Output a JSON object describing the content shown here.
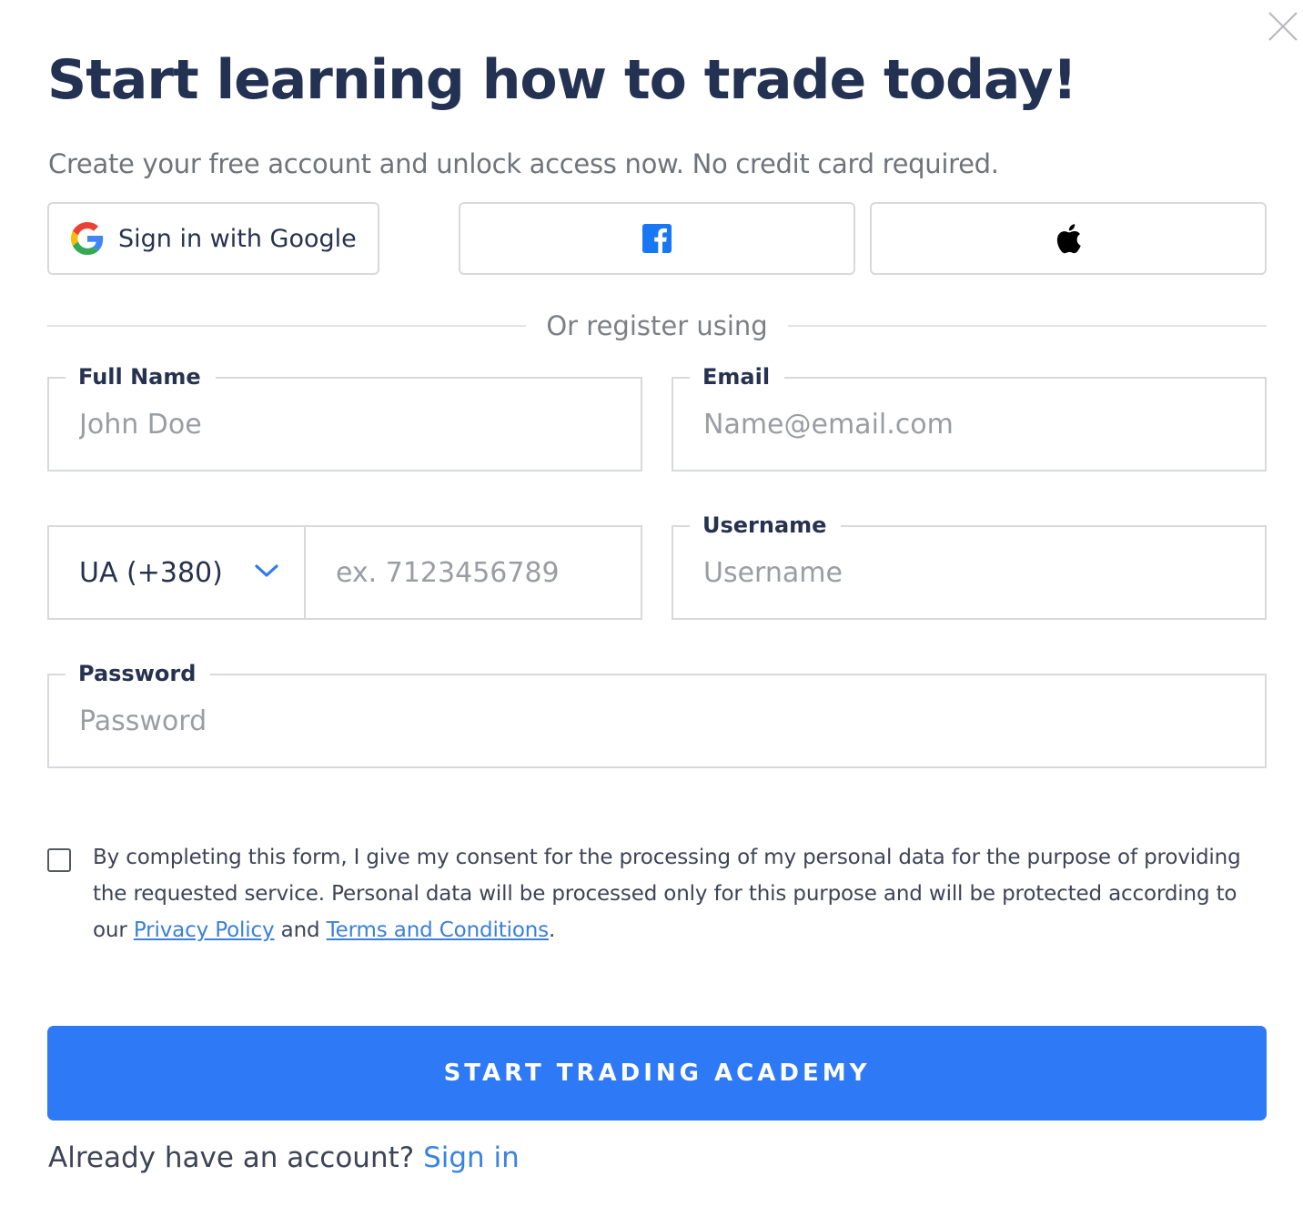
{
  "title": "Start learning how to trade today!",
  "subtitle": "Create your free account and unlock access now. No credit card required.",
  "social": {
    "google_label": "Sign in with Google",
    "facebook_icon": "facebook-icon",
    "apple_icon": "apple-icon"
  },
  "divider_text": "Or register using",
  "fields": {
    "full_name": {
      "label": "Full Name",
      "placeholder": "John Doe"
    },
    "email": {
      "label": "Email",
      "placeholder": "Name@email.com"
    },
    "phone": {
      "country_code": "UA (+380)",
      "placeholder": "ex. 7123456789"
    },
    "username": {
      "label": "Username",
      "placeholder": "Username"
    },
    "password": {
      "label": "Password",
      "placeholder": "Password"
    }
  },
  "consent": {
    "text_before": "By completing this form, I give my consent for the processing of my personal data for the purpose of providing the requested service. Personal data will be processed only for this purpose and will be protected according to our ",
    "privacy_link": "Privacy Policy",
    "text_middle": " and ",
    "terms_link": "Terms and Conditions",
    "text_after": "."
  },
  "cta_label": "START TRADING ACADEMY",
  "signin": {
    "prompt": "Already have an account? ",
    "link": "Sign in"
  },
  "colors": {
    "primary": "#2d79f6",
    "title": "#233152",
    "link": "#3a80d8",
    "facebook": "#1877f2"
  }
}
